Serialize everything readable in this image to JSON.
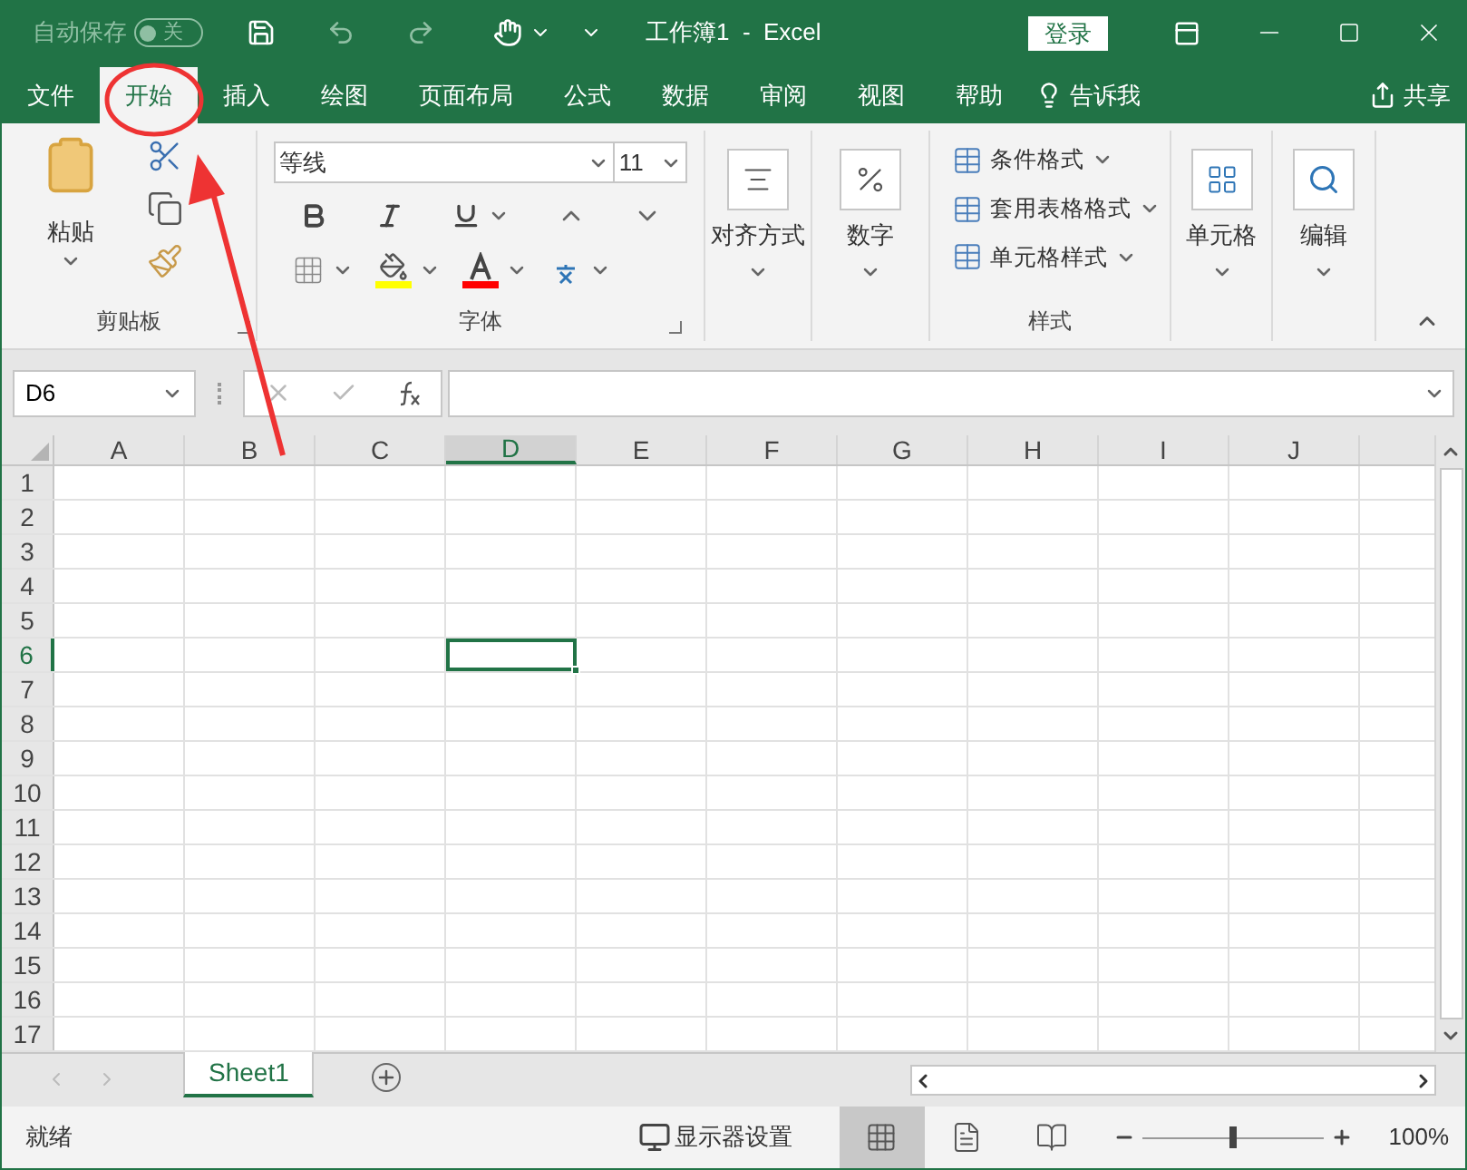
{
  "title_bar": {
    "autosave_label": "自动保存",
    "autosave_toggle": {
      "on": false,
      "label": "关"
    },
    "title": "工作簿1  -  Excel",
    "sign_in": "登录"
  },
  "tabs": [
    {
      "label": "文件",
      "selected": false
    },
    {
      "label": "开始",
      "selected": true
    },
    {
      "label": "插入",
      "selected": false
    },
    {
      "label": "绘图",
      "selected": false
    },
    {
      "label": "页面布局",
      "selected": false
    },
    {
      "label": "公式",
      "selected": false
    },
    {
      "label": "数据",
      "selected": false
    },
    {
      "label": "审阅",
      "selected": false
    },
    {
      "label": "视图",
      "selected": false
    },
    {
      "label": "帮助",
      "selected": false
    }
  ],
  "tell_me": "告诉我",
  "share": "共享",
  "ribbon": {
    "clipboard": {
      "paste": "粘贴",
      "label": "剪贴板"
    },
    "font": {
      "font_name": "等线",
      "font_size": "11",
      "label": "字体"
    },
    "alignment": {
      "label": "对齐方式"
    },
    "number": {
      "label": "数字"
    },
    "styles": {
      "items": [
        "条件格式",
        "套用表格格式",
        "单元格样式"
      ],
      "label": "样式"
    },
    "cells": {
      "label": "单元格"
    },
    "editing": {
      "label": "编辑"
    }
  },
  "formula_bar": {
    "name_box": "D6"
  },
  "columns": [
    {
      "label": "A",
      "selected": false
    },
    {
      "label": "B",
      "selected": false
    },
    {
      "label": "C",
      "selected": false
    },
    {
      "label": "D",
      "selected": true
    },
    {
      "label": "E",
      "selected": false
    },
    {
      "label": "F",
      "selected": false
    },
    {
      "label": "G",
      "selected": false
    },
    {
      "label": "H",
      "selected": false
    },
    {
      "label": "I",
      "selected": false
    },
    {
      "label": "J",
      "selected": false
    }
  ],
  "rows": [
    {
      "label": "1",
      "selected": false
    },
    {
      "label": "2",
      "selected": false
    },
    {
      "label": "3",
      "selected": false
    },
    {
      "label": "4",
      "selected": false
    },
    {
      "label": "5",
      "selected": false
    },
    {
      "label": "6",
      "selected": true
    },
    {
      "label": "7",
      "selected": false
    },
    {
      "label": "8",
      "selected": false
    },
    {
      "label": "9",
      "selected": false
    },
    {
      "label": "10",
      "selected": false
    },
    {
      "label": "11",
      "selected": false
    },
    {
      "label": "12",
      "selected": false
    },
    {
      "label": "13",
      "selected": false
    },
    {
      "label": "14",
      "selected": false
    },
    {
      "label": "15",
      "selected": false
    },
    {
      "label": "16",
      "selected": false
    },
    {
      "label": "17",
      "selected": false
    }
  ],
  "sheets": [
    {
      "name": "Sheet1",
      "selected": true
    }
  ],
  "status_bar": {
    "status": "就绪",
    "display_settings": "显示器设置",
    "view_buttons": [
      {
        "kind": "normal",
        "selected": true
      },
      {
        "kind": "page_layout",
        "selected": false
      },
      {
        "kind": "page_break",
        "selected": false
      }
    ],
    "zoom": {
      "level": 0.5
    },
    "zoom_label": "100%"
  }
}
